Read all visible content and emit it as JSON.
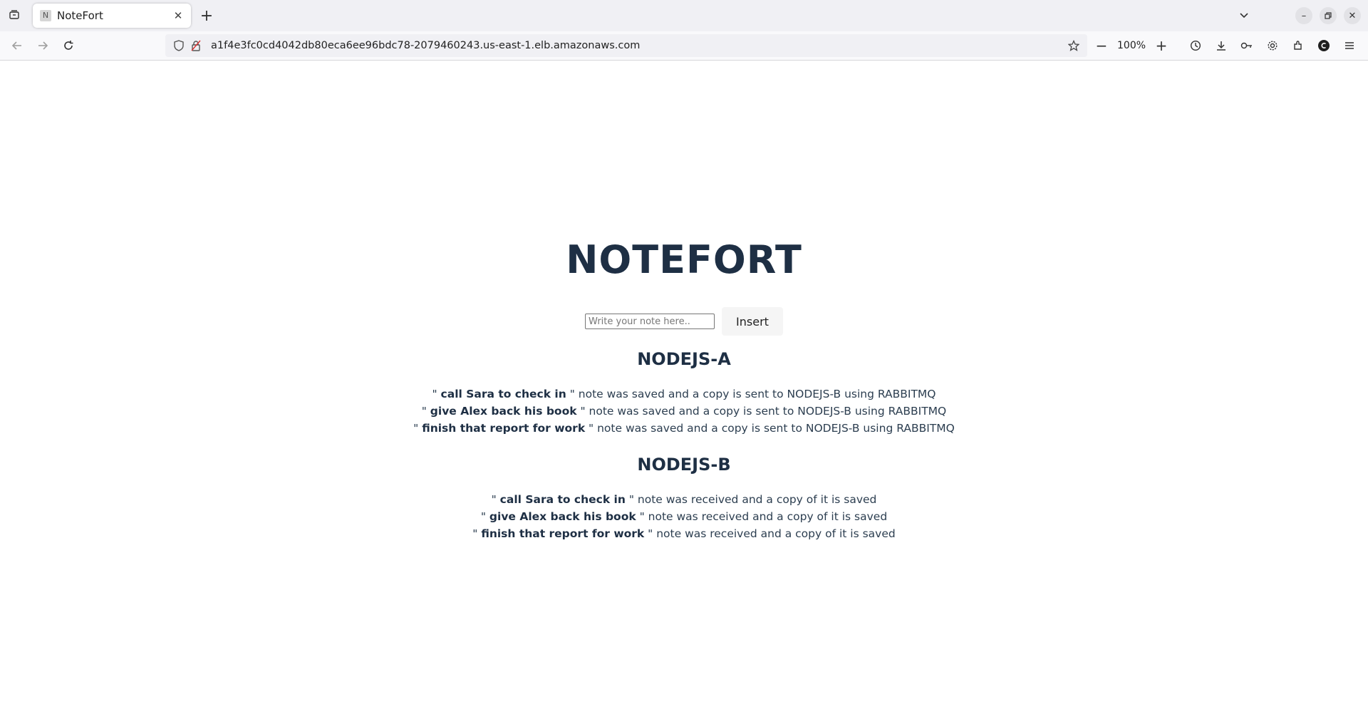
{
  "browser": {
    "tab": {
      "favicon_letter": "N",
      "title": "NoteFort"
    },
    "url": "a1f4e3fc0cd4042db80eca6ee96bdc78-2079460243.us-east-1.elb.amazonaws.com",
    "zoom_level": "100%"
  },
  "app": {
    "title": "NOTEFORT",
    "input": {
      "placeholder": "Write your note here..",
      "value": ""
    },
    "insert_label": "Insert",
    "sections": [
      {
        "title": "NODEJS-A",
        "notes": [
          {
            "prefix": "\" ",
            "text": "call Sara to check in",
            "suffix": " \" note was saved and a copy is sent to NODEJS-B using RABBITMQ"
          },
          {
            "prefix": "\" ",
            "text": "give Alex back his book",
            "suffix": " \" note was saved and a copy is sent to NODEJS-B using RABBITMQ"
          },
          {
            "prefix": "\" ",
            "text": "finish that report for work",
            "suffix": " \" note was saved and a copy is sent to NODEJS-B using RABBITMQ"
          }
        ]
      },
      {
        "title": "NODEJS-B",
        "notes": [
          {
            "prefix": "\" ",
            "text": "call Sara to check in",
            "suffix": " \" note was received and a copy of it is saved"
          },
          {
            "prefix": "\" ",
            "text": "give Alex back his book",
            "suffix": " \" note was received and a copy of it is saved"
          },
          {
            "prefix": "\" ",
            "text": "finish that report for work",
            "suffix": " \" note was received and a copy of it is saved"
          }
        ]
      }
    ]
  }
}
